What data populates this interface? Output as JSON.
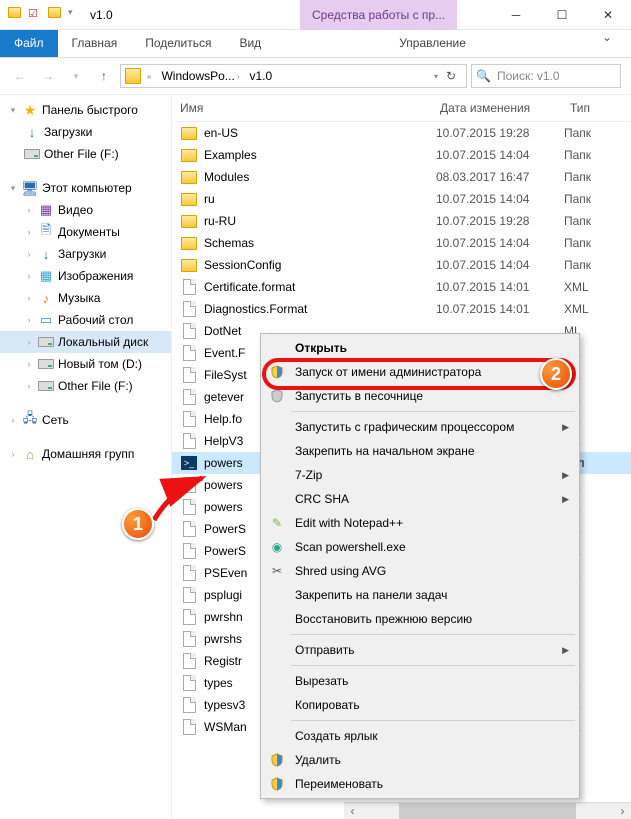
{
  "title": "v1.0",
  "ribbon_context_label": "Средства работы с пр...",
  "ribbon": {
    "file": "Файл",
    "home": "Главная",
    "share": "Поделиться",
    "view": "Вид",
    "manage": "Управление"
  },
  "breadcrumb": {
    "seg1": "WindowsPo...",
    "seg2": "v1.0"
  },
  "search_placeholder": "Поиск: v1.0",
  "sidebar": {
    "quick": "Панель быстрого",
    "downloads": "Загрузки",
    "other_file": "Other File (F:)",
    "this_pc": "Этот компьютер",
    "video": "Видео",
    "documents": "Документы",
    "downloads2": "Загрузки",
    "images": "Изображения",
    "music": "Музыка",
    "desktop": "Рабочий стол",
    "local_disk": "Локальный диск",
    "new_volume": "Новый том (D:)",
    "other_file2": "Other File (F:)",
    "network": "Сеть",
    "homegroup": "Домашняя групп"
  },
  "columns": {
    "name": "Имя",
    "date": "Дата изменения",
    "type": "Тип"
  },
  "files": [
    {
      "name": "en-US",
      "date": "10.07.2015 19:28",
      "type": "Папк",
      "kind": "folder"
    },
    {
      "name": "Examples",
      "date": "10.07.2015 14:04",
      "type": "Папк",
      "kind": "folder"
    },
    {
      "name": "Modules",
      "date": "08.03.2017 16:47",
      "type": "Папк",
      "kind": "folder"
    },
    {
      "name": "ru",
      "date": "10.07.2015 14:04",
      "type": "Папк",
      "kind": "folder"
    },
    {
      "name": "ru-RU",
      "date": "10.07.2015 19:28",
      "type": "Папк",
      "kind": "folder"
    },
    {
      "name": "Schemas",
      "date": "10.07.2015 14:04",
      "type": "Папк",
      "kind": "folder"
    },
    {
      "name": "SessionConfig",
      "date": "10.07.2015 14:04",
      "type": "Папк",
      "kind": "folder"
    },
    {
      "name": "Certificate.format",
      "date": "10.07.2015 14:01",
      "type": "XML",
      "kind": "file"
    },
    {
      "name": "Diagnostics.Format",
      "date": "10.07.2015 14:01",
      "type": "XML",
      "kind": "file"
    },
    {
      "name": "DotNet",
      "date": "",
      "type": "ML",
      "kind": "file"
    },
    {
      "name": "Event.F",
      "date": "",
      "type": "ML",
      "kind": "file"
    },
    {
      "name": "FileSyst",
      "date": "",
      "type": "ML",
      "kind": "file"
    },
    {
      "name": "getever",
      "date": "",
      "type": "ML",
      "kind": "file"
    },
    {
      "name": "Help.fo",
      "date": "",
      "type": "ML",
      "kind": "file"
    },
    {
      "name": "HelpV3",
      "date": "",
      "type": "ML",
      "kind": "file"
    },
    {
      "name": "powers",
      "date": "",
      "type": "рил",
      "kind": "shell",
      "selected": true
    },
    {
      "name": "powers",
      "date": "",
      "type": "ML",
      "kind": "file"
    },
    {
      "name": "powers",
      "date": "",
      "type": "ML",
      "kind": "file"
    },
    {
      "name": "PowerS",
      "date": "",
      "type": "ML",
      "kind": "file"
    },
    {
      "name": "PowerS",
      "date": "",
      "type": "ML",
      "kind": "file"
    },
    {
      "name": "PSEven",
      "date": "",
      "type": "ML",
      "kind": "file"
    },
    {
      "name": "psplugi",
      "date": "",
      "type": "cu",
      "kind": "file"
    },
    {
      "name": "pwrshn",
      "date": "",
      "type": "cu",
      "kind": "file"
    },
    {
      "name": "pwrshs",
      "date": "",
      "type": "cu",
      "kind": "file"
    },
    {
      "name": "Registr",
      "date": "",
      "type": "ML",
      "kind": "file"
    },
    {
      "name": "types",
      "date": "",
      "type": "ML",
      "kind": "file"
    },
    {
      "name": "typesv3",
      "date": "",
      "type": "ML",
      "kind": "file"
    },
    {
      "name": "WSMan",
      "date": "",
      "type": "ML",
      "kind": "file"
    }
  ],
  "context_menu": [
    {
      "label": "Открыть",
      "default": true
    },
    {
      "label": "Запуск от имени администратора",
      "icon": "shield"
    },
    {
      "label": "Запустить в песочнице",
      "icon": "shield-grey"
    },
    {
      "sep": true
    },
    {
      "label": "Запустить с графическим процессором",
      "submenu": true
    },
    {
      "label": "Закрепить на начальном экране"
    },
    {
      "label": "7-Zip",
      "submenu": true
    },
    {
      "label": "CRC SHA",
      "submenu": true
    },
    {
      "label": "Edit with Notepad++",
      "icon": "npp"
    },
    {
      "label": "Scan powershell.exe",
      "icon": "avg-scan"
    },
    {
      "label": "Shred using AVG",
      "icon": "avg-shred"
    },
    {
      "label": "Закрепить на панели задач"
    },
    {
      "label": "Восстановить прежнюю версию"
    },
    {
      "sep": true
    },
    {
      "label": "Отправить",
      "submenu": true
    },
    {
      "sep": true
    },
    {
      "label": "Вырезать"
    },
    {
      "label": "Копировать"
    },
    {
      "sep": true
    },
    {
      "label": "Создать ярлык"
    },
    {
      "label": "Удалить",
      "icon": "shield"
    },
    {
      "label": "Переименовать",
      "icon": "shield"
    }
  ]
}
